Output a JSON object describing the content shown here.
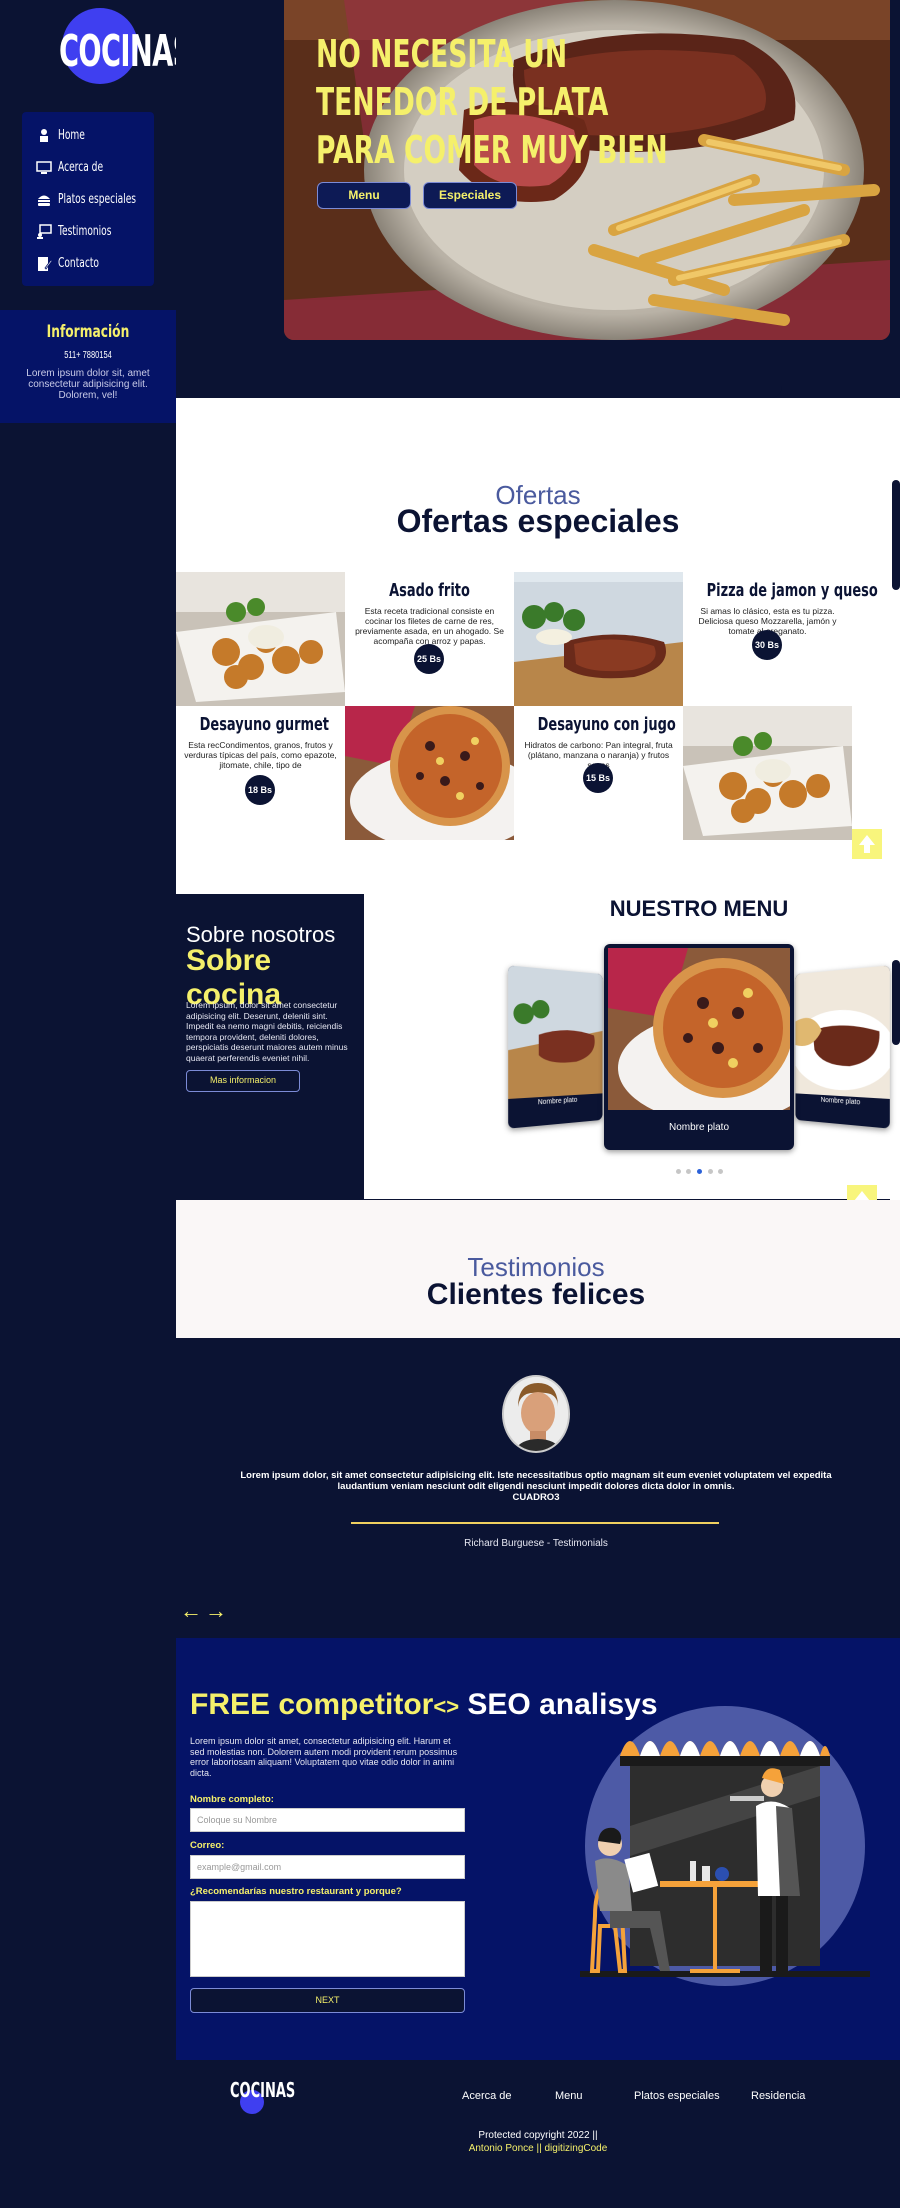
{
  "brand": {
    "logo": "COCINAS"
  },
  "sidebar": {
    "items": [
      {
        "label": "Home",
        "icon": "home-icon"
      },
      {
        "label": "Acerca de",
        "icon": "monitor-icon"
      },
      {
        "label": "Platos especiales",
        "icon": "burger-icon"
      },
      {
        "label": "Testimonios",
        "icon": "chat-icon"
      },
      {
        "label": "Contacto",
        "icon": "contact-icon"
      }
    ],
    "info": {
      "title": "Información",
      "phone": "511+ 7880154",
      "text": "Lorem ipsum dolor sit, amet consectetur adipisicing elit. Dolorem, vel!"
    }
  },
  "hero": {
    "title_lines": [
      "NO NECESITA UN",
      "TENEDOR DE PLATA",
      "PARA COMER MUY BIEN"
    ],
    "btn_menu": "Menu",
    "btn_especiales": "Especiales"
  },
  "ofertas": {
    "subtitle": "Ofertas",
    "title": "Ofertas especiales",
    "items": [
      {
        "title": "Asado frito",
        "desc": "Esta receta tradicional consiste en cocinar los filetes de carne de res, previamente asada, en un ahogado. Se acompaña con arroz y papas.",
        "price": "25 Bs"
      },
      {
        "title": "Pizza de jamon y queso",
        "desc": "Si amas lo clásico, esta es tu pizza. Deliciosa queso Mozzarella, jamón y tomate al oreganato.",
        "price": "30 Bs"
      },
      {
        "title": "Desayuno gurmet",
        "desc": "Esta recCondimentos, granos, frutos y verduras típicas del país, como epazote, jitomate, chile, tipo de",
        "price": "18 Bs"
      },
      {
        "title": "Desayuno con jugo",
        "desc": "Hidratos de carbono: Pan integral, fruta (plátano, manzana o naranja) y frutos secos",
        "price": "15 Bs"
      }
    ]
  },
  "about": {
    "subtitle": "Sobre nosotros",
    "title": "Sobre cocina",
    "text": "Lorem ipsum, dolor sit amet consectetur adipisicing elit. Deserunt, deleniti sint. Impedit ea nemo magni debitis, reiciendis tempora provident, deleniti dolores, perspiciatis deserunt maiores autem minus quaerat perferendis eveniet nihil.",
    "button": "Mas informacion"
  },
  "menu": {
    "title": "NUESTRO MENU",
    "cards": [
      {
        "label": "Nombre plato"
      },
      {
        "label": "Nombre plato"
      },
      {
        "label": "Nombre plato"
      }
    ],
    "active_dot": 2,
    "dot_count": 5
  },
  "testimonials": {
    "subtitle": "Testimonios",
    "title": "Clientes felices",
    "text": "Lorem ipsum dolor, sit amet consectetur adipisicing elit. Iste necessitatibus optio magnam sit eum eveniet voluptatem vel expedita laudantium veniam nesciunt odit eligendi nesciunt impedit dolores dicta dolor in omnis.",
    "code": "CUADRO3",
    "author": "Richard Burguese - Testimonials",
    "prev": "←",
    "next": "→"
  },
  "seo": {
    "title_yellow": "FREE competitor",
    "title_white": "SEO analisys",
    "text": "Lorem ipsum dolor sit amet, consectetur adipisicing elit. Harum et sed molestias non. Dolorem autem modi provident rerum possimus error laboriosam aliquam! Voluptatem quo vitae odio dolor in animi dicta.",
    "name_label": "Nombre completo:",
    "name_placeholder": "Coloque su Nombre",
    "email_label": "Correo:",
    "email_placeholder": "example@gmail.com",
    "recommend_label": "¿Recomendarías nuestro restaurant y porque?",
    "button": "NEXT"
  },
  "footer": {
    "logo": "COCINAS",
    "links": [
      "Acerca de",
      "Menu",
      "Platos especiales",
      "Residencia"
    ],
    "copyright": "Protected copyright 2022 ||",
    "author": "Antonio Ponce || digitizingCode"
  },
  "colors": {
    "navy": "#0b1333",
    "royal": "#051367",
    "accent_yellow": "#f5f06b",
    "logo_blue": "#3f3ff0"
  }
}
